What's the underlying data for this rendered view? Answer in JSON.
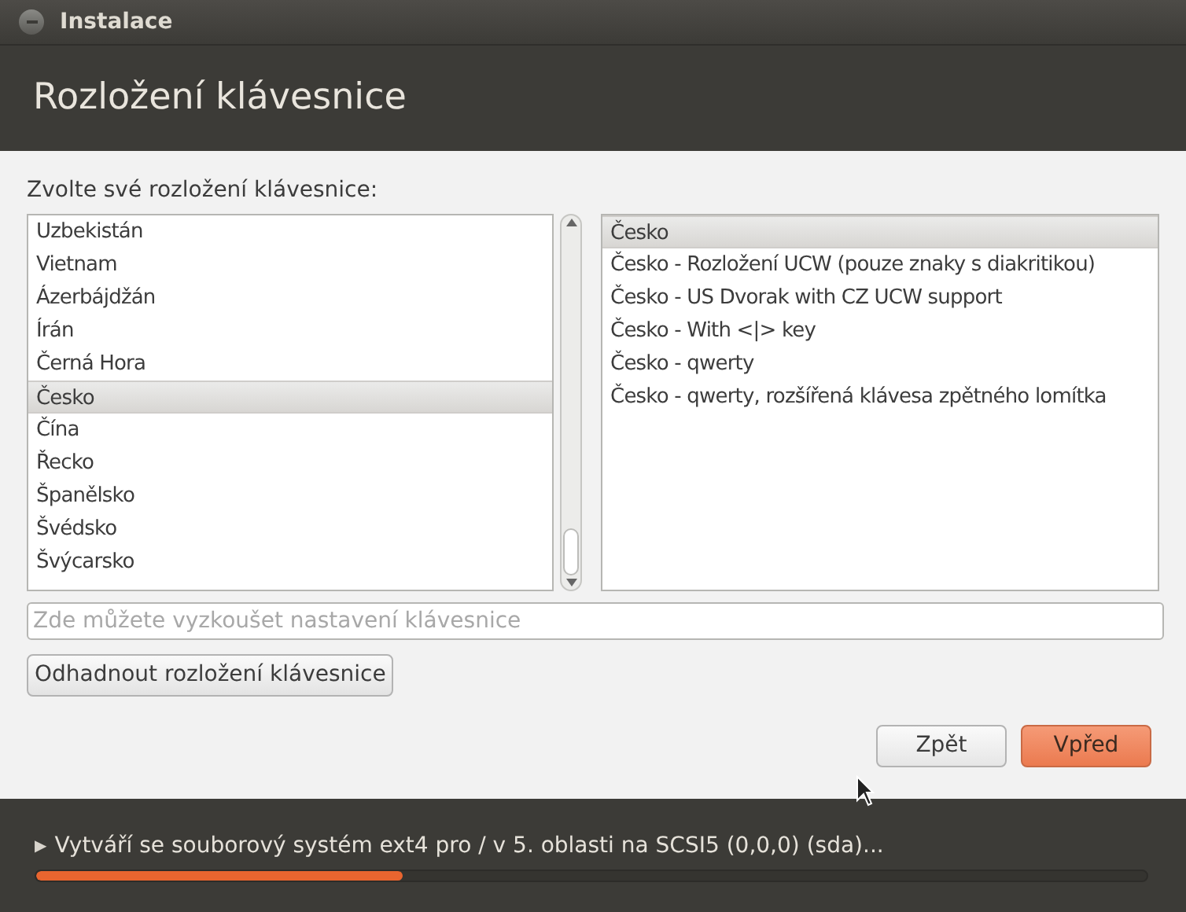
{
  "window": {
    "title": "Instalace"
  },
  "header": {
    "title": "Rozložení klávesnice"
  },
  "prompt": "Zvolte své rozložení klávesnice:",
  "countries": [
    {
      "label": "Uzbekistán",
      "selected": false
    },
    {
      "label": "Vietnam",
      "selected": false
    },
    {
      "label": "Ázerbájdžán",
      "selected": false
    },
    {
      "label": "Írán",
      "selected": false
    },
    {
      "label": "Černá Hora",
      "selected": false
    },
    {
      "label": "Česko",
      "selected": true
    },
    {
      "label": "Čína",
      "selected": false
    },
    {
      "label": "Řecko",
      "selected": false
    },
    {
      "label": "Španělsko",
      "selected": false
    },
    {
      "label": "Švédsko",
      "selected": false
    },
    {
      "label": "Švýcarsko",
      "selected": false
    }
  ],
  "variants": [
    {
      "label": "Česko",
      "selected": true
    },
    {
      "label": "Česko - Rozložení UCW (pouze znaky s diakritikou)",
      "selected": false
    },
    {
      "label": "Česko - US Dvorak with CZ UCW support",
      "selected": false
    },
    {
      "label": "Česko - With <|> key",
      "selected": false
    },
    {
      "label": "Česko - qwerty",
      "selected": false
    },
    {
      "label": "Česko - qwerty, rozšířená klávesa zpětného lomítka",
      "selected": false
    }
  ],
  "test_field": {
    "placeholder": "Zde můžete vyzkoušet nastavení klávesnice"
  },
  "detect_button": "Odhadnout rozložení klávesnice",
  "buttons": [
    {
      "label": "Zpět",
      "kind": "secondary"
    },
    {
      "label": "Vpřed",
      "kind": "primary"
    }
  ],
  "status": {
    "arrow": "▶",
    "text": "Vytváří se souborový systém ext4 pro / v 5. oblasti na SCSI5 (0,0,0) (sda)...",
    "level": 0.33
  }
}
